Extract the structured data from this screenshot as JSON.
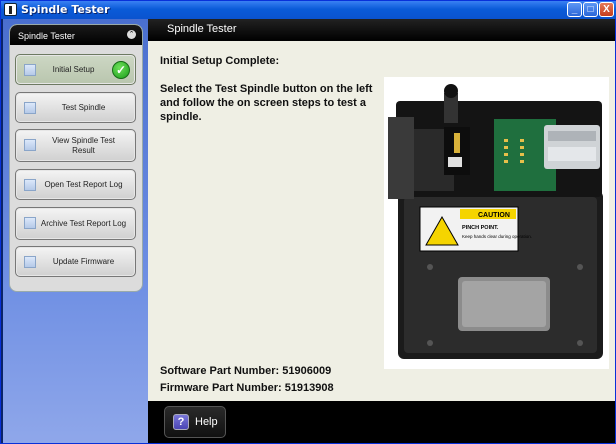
{
  "window": {
    "title": "Spindle Tester",
    "controls": [
      "_",
      "□",
      "X"
    ]
  },
  "sidebar": {
    "panel_title": "Spindle Tester",
    "items": [
      {
        "label": "Initial Setup",
        "status": "complete"
      },
      {
        "label": "Test Spindle"
      },
      {
        "label": "View Spindle Test Result"
      },
      {
        "label": "Open Test Report Log"
      },
      {
        "label": "Archive Test Report Log"
      },
      {
        "label": "Update Firmware"
      }
    ]
  },
  "main": {
    "header": "Spindle Tester",
    "heading": "Initial Setup Complete:",
    "instructions": "Select the Test Spindle button on the left and follow the on screen steps to test a spindle.",
    "software_part": "Software Part Number: 51906009",
    "firmware_part": "Firmware Part Number: 51913908"
  },
  "device_photo": {
    "caution_label": "CAUTION",
    "caution_title": "PINCH POINT.",
    "caution_text": "Keep hands clear during operation."
  },
  "footer": {
    "help_label": "Help",
    "help_icon": "?"
  },
  "colors": {
    "sidebar_top": "#4a6fcf",
    "content_bg": "#efefe4",
    "header_bg": "#000000",
    "check_green": "#1a9d1a"
  }
}
